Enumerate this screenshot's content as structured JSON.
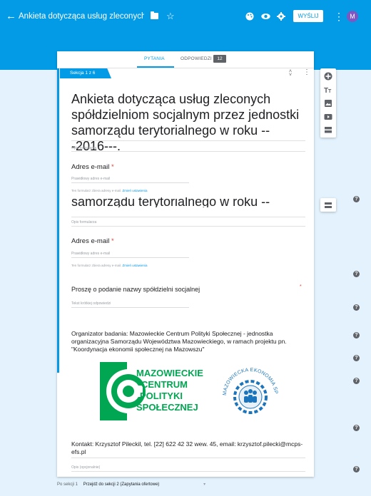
{
  "header": {
    "doc_title": "Ankieta dotycząca usług zleconych spó",
    "send_label": "WYŚLIJ",
    "avatar_letter": "M",
    "more_glyph": "⋮",
    "star_glyph": "☆",
    "back_glyph": "←"
  },
  "tabs": {
    "questions": "PYTANIA",
    "responses": "ODPOWIEDZI",
    "responses_count": "12"
  },
  "section": {
    "label": "Sekcja 1 z 6"
  },
  "form": {
    "title": "Ankieta dotycząca usług zleconych spółdzielniom socjalnym przez jednostki samorządu terytorialnego w roku ---2016---.",
    "title_clip": "samorządu terytorialnego w roku ---2016---.",
    "description_placeholder": "Opis formularza",
    "email_question": "Adres e-mail",
    "email_placeholder": "Prawidłowy adres e-mail",
    "collect_note": "Ten formularz zbiera adresy e-mail.",
    "collect_link": "Zmień ustawienia",
    "question_coop": "Proszę o podanie nazwy spółdzielni socjalnej",
    "short_answer_placeholder": "Tekst krótkiej odpowiedzi",
    "organizer_text": "Organizator badania: Mazowieckie Centrum Polityki Społecznej - jednostka organizacyjna Samorządu Województwa Mazowieckiego, w ramach projektu pn. \"Koordynacja ekonomii społecznej na Mazowszu\"",
    "contact_text": "Kontakt: Krzysztof Pileckil, tel. [22] 622 42 32 wew. 45, email: krzysztof.pilecki@mcps-efs.pl",
    "optional_desc": "Opis (opcjonalnie)",
    "required_mark": "*"
  },
  "logos": {
    "mcps_lines": [
      "MAZOWIECKIE",
      "CENTRUM",
      "POLITYKI",
      "SPOŁECZNEJ"
    ],
    "eco_text": "MAZOWIECKA EKONOMIA SPOŁECZNA"
  },
  "footer": {
    "after_section": "Po sekcji 1",
    "goto": "Przejdź do sekcji 2 (Zapytania ofertowe)"
  },
  "colors": {
    "accent": "#039be5",
    "mcps_green": "#00a651",
    "eco_blue": "#1b75bc"
  }
}
